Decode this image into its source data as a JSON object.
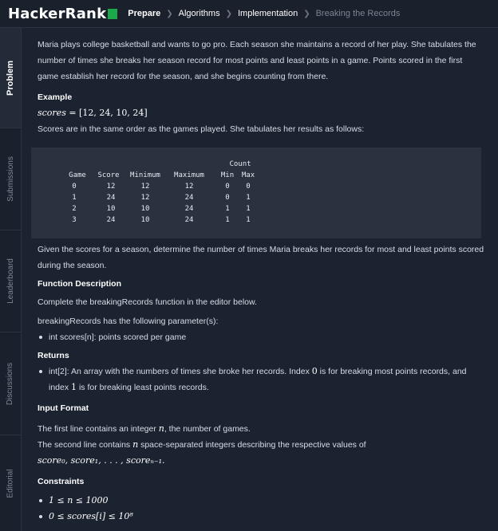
{
  "header": {
    "logo_text": "HackerRank",
    "breadcrumbs": [
      "Prepare",
      "Algorithms",
      "Implementation",
      "Breaking the Records"
    ],
    "brand_color": "#1ba94c"
  },
  "sidebar": {
    "tabs": [
      "Problem",
      "Submissions",
      "Leaderboard",
      "Discussions",
      "Editorial"
    ]
  },
  "problem": {
    "intro": "Maria plays college basketball and wants to go pro. Each season she maintains a record of her play. She tabulates the number of times she breaks her season record for most points and least points in a game. Points scored in the first game establish her record for the season, and she begins counting from there.",
    "example_heading": "Example",
    "example_var": "scores",
    "example_value": " = [12, 24, 10, 24]",
    "tabulate_text": "Scores are in the same order as the games played. She tabulates her results as follows:",
    "table": {
      "count_header": "Count",
      "headers": [
        "Game",
        "Score",
        "Minimum",
        "Maximum",
        "Min",
        "Max"
      ],
      "rows": [
        [
          "0",
          "12",
          "12",
          "12",
          "0",
          "0"
        ],
        [
          "1",
          "24",
          "12",
          "24",
          "0",
          "1"
        ],
        [
          "2",
          "10",
          "10",
          "24",
          "1",
          "1"
        ],
        [
          "3",
          "24",
          "10",
          "24",
          "1",
          "1"
        ]
      ]
    },
    "given_text": "Given the scores for a season, determine the number of times Maria breaks her records for most and least points scored during the season.",
    "function_heading": "Function Description",
    "function_text": "Complete the breakingRecords function in the editor below.",
    "params_text": "breakingRecords has the following parameter(s):",
    "param_item": "int scores[n]: points scored per game",
    "returns_heading": "Returns",
    "returns_a": "int[2]: An array with the numbers of times she broke her records. Index ",
    "returns_idx0": "0",
    "returns_b": " is for breaking most points records, and index ",
    "returns_idx1": "1",
    "returns_c": " is for breaking least points records.",
    "input_heading": "Input Format",
    "input_line1_a": "The first line contains an integer ",
    "input_line1_var": "n",
    "input_line1_b": ", the number of games.",
    "input_line2_a": "The second line contains ",
    "input_line2_var": "n",
    "input_line2_b": " space-separated integers describing the respective values of",
    "input_line3": "score₀, score₁, . . . , scoreₙ₋₁.",
    "constraints_heading": "Constraints",
    "constraint1": "1 ≤ n ≤ 1000",
    "constraint2": "0 ≤ scores[i] ≤ 10⁸"
  }
}
